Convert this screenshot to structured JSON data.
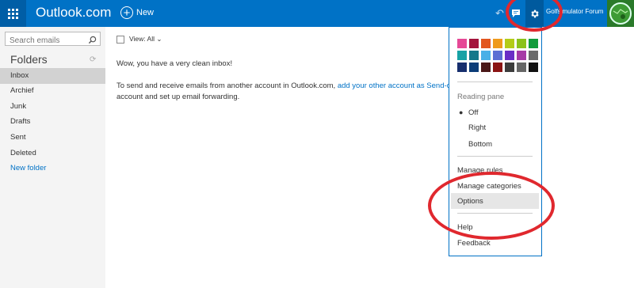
{
  "topbar": {
    "brand": "Outlook.com",
    "new_label": "New",
    "user_name": "Golfsimulator Forum"
  },
  "sidebar": {
    "search_placeholder": "Search emails",
    "folders_title": "Folders",
    "folders": [
      "Inbox",
      "Archief",
      "Junk",
      "Drafts",
      "Sent",
      "Deleted"
    ],
    "new_folder": "New folder"
  },
  "main": {
    "view_label": "View: All",
    "empty_message": "Wow, you have a very clean inbox!",
    "send_text_before": "To send and receive emails from another account in Outlook.com, ",
    "send_link": "add your other account as Send-only",
    "send_text_after": "account and set up email forwarding."
  },
  "settings_menu": {
    "theme_colors": [
      "#e64896",
      "#a4133c",
      "#e2561e",
      "#ef9a1b",
      "#b3cc17",
      "#8bc21b",
      "#129c3b",
      "#17a2a5",
      "#16788a",
      "#49b0e7",
      "#5b6fd4",
      "#6a2ec6",
      "#a63aa6",
      "#6a6a6a",
      "#172f6e",
      "#0b3c78",
      "#4a1818",
      "#8a1414",
      "#3c3c3c",
      "#666666",
      "#111111"
    ],
    "reading_pane_label": "Reading pane",
    "reading_pane_options": [
      "Off",
      "Right",
      "Bottom"
    ],
    "reading_pane_selected": "Off",
    "items": [
      "Manage rules",
      "Manage categories",
      "Options",
      "Help",
      "Feedback"
    ]
  },
  "colors": {
    "accent": "#0072c6",
    "annotation": "#e0282e"
  }
}
